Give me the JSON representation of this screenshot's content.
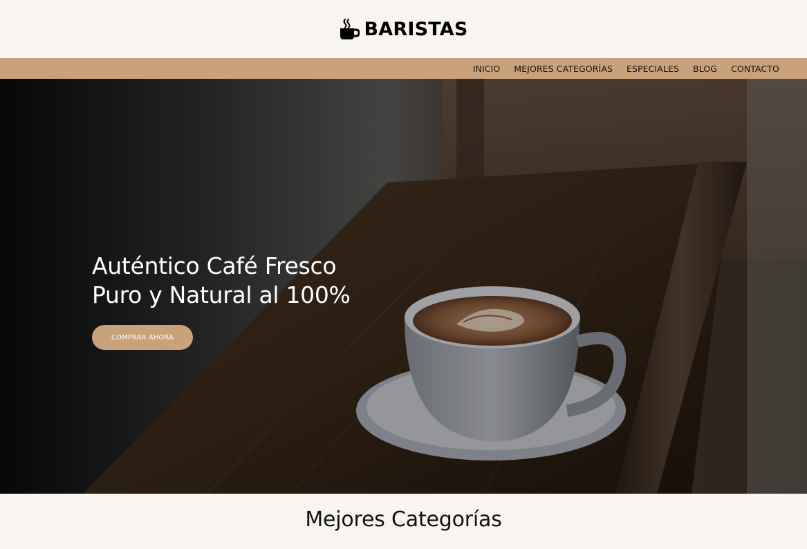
{
  "brand": {
    "name": "BARISTAS",
    "icon": "coffee-cup-icon"
  },
  "nav": {
    "items": [
      {
        "label": "INICIO"
      },
      {
        "label": "MEJORES CATEGORÍAS"
      },
      {
        "label": "ESPECIALES"
      },
      {
        "label": "BLOG"
      },
      {
        "label": "CONTACTO"
      }
    ]
  },
  "hero": {
    "title_line1": "Auténtico Café Fresco",
    "title_line2": "Puro y Natural al 100%",
    "cta_label": "COMPRAR AHORA"
  },
  "sections": {
    "categories_title": "Mejores Categorías"
  },
  "colors": {
    "accent": "#c9a27b",
    "background": "#f8f5f0",
    "text": "#111111"
  }
}
